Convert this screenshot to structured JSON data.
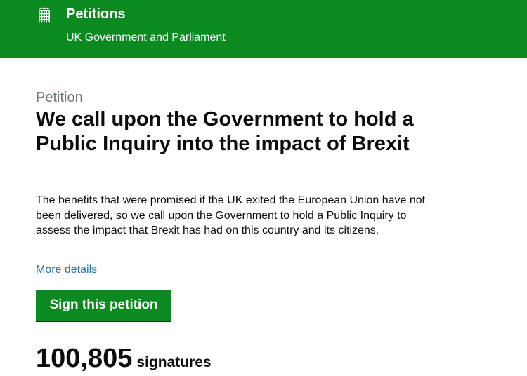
{
  "header": {
    "icon": "portcullis-icon",
    "title": "Petitions",
    "subtitle": "UK Government and Parliament",
    "background_color": "#0b8a1f"
  },
  "petition": {
    "caption": "Petition",
    "title": "We call upon the Government to hold a Public Inquiry into the impact of Brexit",
    "description": "The benefits that were promised if the UK exited the European Union have not been delivered, so we call upon the Government to hold a Public Inquiry to assess the impact that Brexit has had on this country and its citizens.",
    "more_details_link": "More details",
    "link_color": "#1d70b8",
    "sign_button_label": "Sign this petition",
    "button_color": "#0b8a1f"
  },
  "signatures": {
    "count": "100,805",
    "label": "signatures"
  }
}
